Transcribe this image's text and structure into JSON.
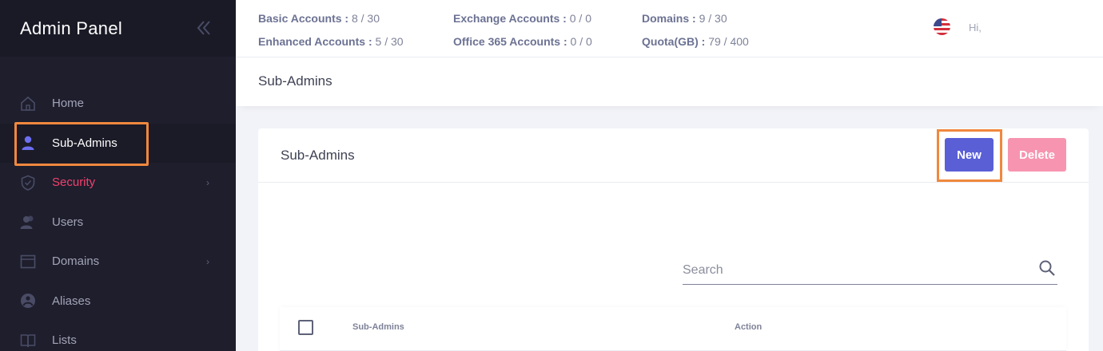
{
  "sidebar": {
    "brand": "Admin Panel",
    "items": [
      {
        "label": "Home",
        "icon": "home-icon"
      },
      {
        "label": "Sub-Admins",
        "icon": "user-icon",
        "active": true
      },
      {
        "label": "Security",
        "icon": "shield-icon",
        "has_submenu": true
      },
      {
        "label": "Users",
        "icon": "users-icon"
      },
      {
        "label": "Domains",
        "icon": "browser-window-icon",
        "has_submenu": true
      },
      {
        "label": "Aliases",
        "icon": "aliases-icon"
      },
      {
        "label": "Lists",
        "icon": "book-icon"
      }
    ]
  },
  "stats": {
    "basic": {
      "label": "Basic Accounts :",
      "value": "8 / 30"
    },
    "enhanced": {
      "label": "Enhanced Accounts :",
      "value": "5 / 30"
    },
    "exchange": {
      "label": "Exchange Accounts :",
      "value": "0 / 0"
    },
    "office": {
      "label": "Office 365 Accounts :",
      "value": "0 / 0"
    },
    "domains": {
      "label": "Domains :",
      "value": "9 / 30"
    },
    "quota": {
      "label": "Quota(GB) :",
      "value": "79 / 400"
    }
  },
  "header": {
    "greeting": "Hi,"
  },
  "subheader": {
    "title": "Sub-Admins"
  },
  "card": {
    "title": "Sub-Admins",
    "new_label": "New",
    "delete_label": "Delete",
    "search_placeholder": "Search",
    "columns": [
      "Sub-Admins",
      "Action"
    ]
  },
  "colors": {
    "sidebar_bg": "#1e1e2d",
    "accent_primary": "#5a5fd6",
    "accent_danger": "#f1416c",
    "delete_button": "#f794b0",
    "highlight_outline": "#f0883e"
  }
}
